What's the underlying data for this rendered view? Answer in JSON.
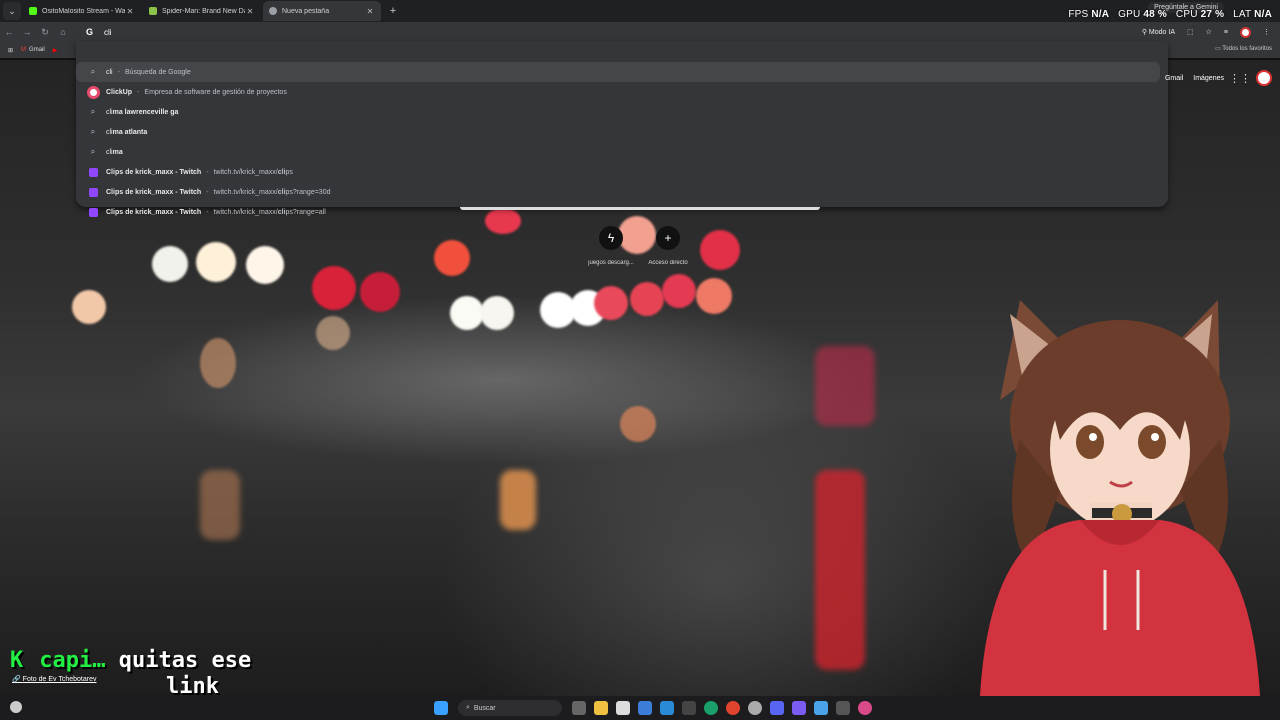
{
  "tabs": [
    {
      "title": "OsitoMalosito Stream - Watch",
      "favicon_color": "#53fc18",
      "active": false
    },
    {
      "title": "Spider-Man: Brand New Day e",
      "favicon_color": "#8bc34a",
      "active": false
    },
    {
      "title": "Nueva pestaña",
      "favicon_color": "#9aa0a6",
      "active": true
    }
  ],
  "stats": {
    "fps_label": "FPS",
    "fps": "N/A",
    "gpu_label": "GPU",
    "gpu": "48 %",
    "cpu_label": "CPU",
    "cpu": "27 %",
    "lat_label": "LAT",
    "lat": "N/A"
  },
  "gemini": "Pregúntale a Gemini",
  "omnibox": {
    "value": "cli",
    "engine_icon": "G"
  },
  "toolbar": {
    "ai_mode": "Modo IA"
  },
  "bookmarks": {
    "gmail": "Gmail",
    "all_favorites": "Todos los favoritos"
  },
  "suggestions": [
    {
      "icon": "search-icon",
      "strong": "",
      "text": "cli",
      "sep": "-",
      "detail": "Búsqueda de Google"
    },
    {
      "icon": "clickup-icon",
      "strong": "ClickUp",
      "text": "",
      "sep": "-",
      "detail": "Empresa de software de gestión de proyectos"
    },
    {
      "icon": "search-icon",
      "strong": "ma lawrenceville ga",
      "pre": "cli",
      "text": "",
      "sep": "",
      "detail": ""
    },
    {
      "icon": "search-icon",
      "strong": "ma atlanta",
      "pre": "cli",
      "text": "",
      "sep": "",
      "detail": ""
    },
    {
      "icon": "search-icon",
      "strong": "ma",
      "pre": "cli",
      "text": "",
      "sep": "",
      "detail": ""
    },
    {
      "icon": "twitch-icon",
      "strong": "Cli",
      "text": "ps de krick_maxx - Twitch",
      "sep": "-",
      "detail_pre": "twitch.tv/krick_maxx/",
      "detail_bold": "cli",
      "detail_post": "ps"
    },
    {
      "icon": "twitch-icon",
      "strong": "Cli",
      "text": "ps de krick_maxx - Twitch",
      "sep": "-",
      "detail_pre": "twitch.tv/krick_maxx/",
      "detail_bold": "cli",
      "detail_post": "ps?range=30d"
    },
    {
      "icon": "twitch-icon",
      "strong": "Cli",
      "text": "ps de krick_maxx - Twitch",
      "sep": "-",
      "detail_pre": "twitch.tv/krick_maxx/",
      "detail_bold": "cli",
      "detail_post": "ps?range=all"
    }
  ],
  "google_header": {
    "gmail": "Gmail",
    "images": "Imágenes"
  },
  "shortcuts": [
    {
      "label": "juegos descarg...",
      "icon": "bolt-icon"
    },
    {
      "label": "Acceso directo",
      "icon": "plus-icon"
    }
  ],
  "caption": {
    "k": "K",
    "name": "capi…",
    "line1": "quitas ese",
    "line2": "link"
  },
  "photo_credit": "Foto de Ev Tchebotarev",
  "taskbar": {
    "search": "Buscar"
  }
}
